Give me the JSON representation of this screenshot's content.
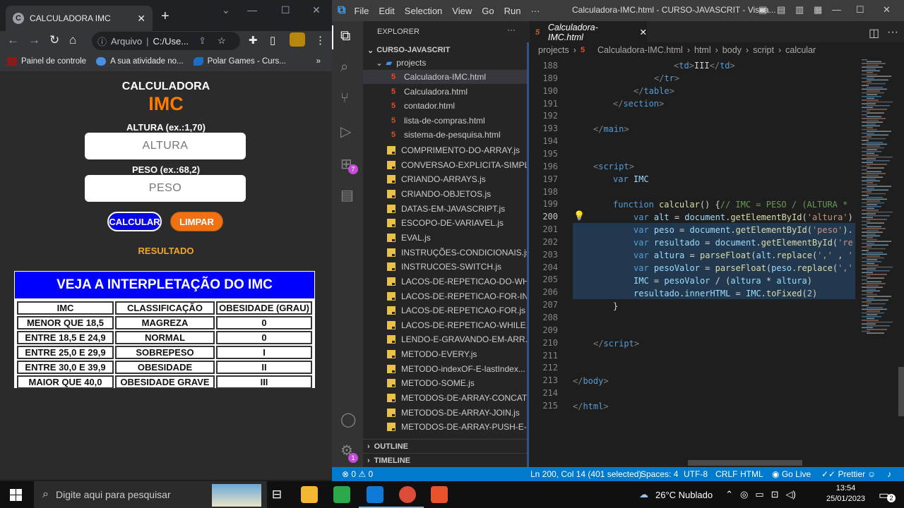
{
  "browser": {
    "tab_title": "CALCULADORA IMC",
    "tab_favicon": "C",
    "new_tab": "+",
    "omnibox": {
      "security_label": "Arquivo",
      "url": "C:/Use..."
    },
    "bookmarks": [
      {
        "label": "Painel de controle",
        "icon": "folder-icon",
        "color": "#8b1a1a"
      },
      {
        "label": "A sua atividade no...",
        "icon": "cloud-icon",
        "color": "#4a90e2"
      },
      {
        "label": "Polar Games - Curs...",
        "icon": "polar-icon",
        "color": "#1a6fbf"
      }
    ],
    "bookmarks_more": "»"
  },
  "page": {
    "title_small": "CALCULADORA",
    "title_big": "IMC",
    "altura_label": "ALTURA (ex.:1,70)",
    "altura_placeholder": "ALTURA",
    "peso_label": "PESO (ex.:68,2)",
    "peso_placeholder": "PESO",
    "calc_button": "CALCULAR",
    "clear_button": "LIMPAR",
    "result_label": "RESULTADO",
    "table_title": "VEJA A INTERPLETAÇÃO DO IMC",
    "table_headers": [
      "IMC",
      "CLASSIFICAÇÃO",
      "OBESIDADE (GRAU)"
    ],
    "table_rows": [
      [
        "MENOR QUE 18,5",
        "MAGREZA",
        "0"
      ],
      [
        "ENTRE 18,5 E 24,9",
        "NORMAL",
        "0"
      ],
      [
        "ENTRE 25,0 E 29,9",
        "SOBREPESO",
        "I"
      ],
      [
        "ENTRE 30,0 E 39,9",
        "OBESIDADE",
        "II"
      ],
      [
        "MAIOR QUE 40,0",
        "OBESIDADE GRAVE",
        "III"
      ]
    ]
  },
  "vscode": {
    "menu": [
      "File",
      "Edit",
      "Selection",
      "View",
      "Go",
      "Run",
      "···"
    ],
    "window_title": "Calculadora-IMC.html - CURSO-JAVASCRIT - Visua...",
    "explorer_title": "EXPLORER",
    "explorer_more": "···",
    "root_folder": "CURSO-JAVASCRIT",
    "subfolder": "projects",
    "project_files": [
      "Calculadora-IMC.html",
      "Calculadora.html",
      "contador.html",
      "lista-de-compras.html",
      "sistema-de-pesquisa.html"
    ],
    "js_files": [
      "COMPRIMENTO-DO-ARRAY.js",
      "CONVERSAO-EXPLICITA-SIMPL...",
      "CRIANDO-ARRAYS.js",
      "CRIANDO-OBJETOS.js",
      "DATAS-EM-JAVASCRIPT.js",
      "ESCOPO-DE-VARIAVEL.js",
      "EVAL.js",
      "INSTRUÇÕES-CONDICIONAIS.js",
      "INSTRUCOES-SWITCH.js",
      "LACOS-DE-REPETICAO-DO-WH...",
      "LACOS-DE-REPETICAO-FOR-IN.js",
      "LACOS-DE-REPETICAO-FOR.js",
      "LACOS-DE-REPETICAO-WHILE.js",
      "LENDO-E-GRAVANDO-EM-ARR...",
      "METODO-EVERY.js",
      "METODO-indexOF-E-lastIndex...",
      "METODO-SOME.js",
      "METODOS-DE-ARRAY-CONCAT.js",
      "METODOS-DE-ARRAY-JOIN.js",
      "METODOS-DE-ARRAY-PUSH-E-..."
    ],
    "outline": "OUTLINE",
    "timeline": "TIMELINE",
    "extensions_badge": "7",
    "settings_badge": "1",
    "editor_tab": "Calculadora-IMC.html",
    "breadcrumb": [
      "projects",
      "Calculadora-IMC.html",
      "html",
      "body",
      "script",
      "calcular"
    ],
    "line_numbers": [
      "188",
      "189",
      "190",
      "191",
      "192",
      "193",
      "194",
      "195",
      "196",
      "197",
      "198",
      "199",
      "200",
      "201",
      "202",
      "203",
      "204",
      "205",
      "206",
      "207",
      "208",
      "209",
      "210",
      "211",
      "212",
      "213",
      "214",
      "215"
    ],
    "status": {
      "errors": "0",
      "warnings": "0",
      "position": "Ln 200, Col 14 (401 selected)",
      "spaces": "Spaces: 4",
      "encoding": "UTF-8",
      "eol": "CRLF",
      "language": "HTML",
      "golive": "Go Live",
      "prettier": "Prettier"
    }
  },
  "taskbar": {
    "search_placeholder": "Digite aqui para pesquisar",
    "weather": "26°C  Nublado",
    "time": "13:54",
    "date": "25/01/2023",
    "notifications": "2"
  }
}
